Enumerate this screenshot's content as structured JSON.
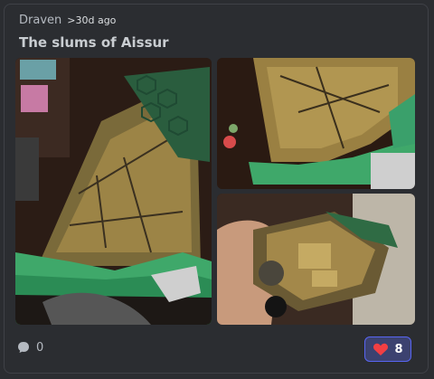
{
  "post": {
    "author": "Draven",
    "time": ">30d ago",
    "title": "The slums of Aissur"
  },
  "images": [
    {
      "icon": "photo"
    },
    {
      "icon": "photo"
    },
    {
      "icon": "photo"
    }
  ],
  "footer": {
    "comment_count": "0",
    "like_count": "8",
    "colors": {
      "like_border": "#5865f2",
      "like_bg": "#3c4270",
      "heart": "#f23f43"
    }
  }
}
